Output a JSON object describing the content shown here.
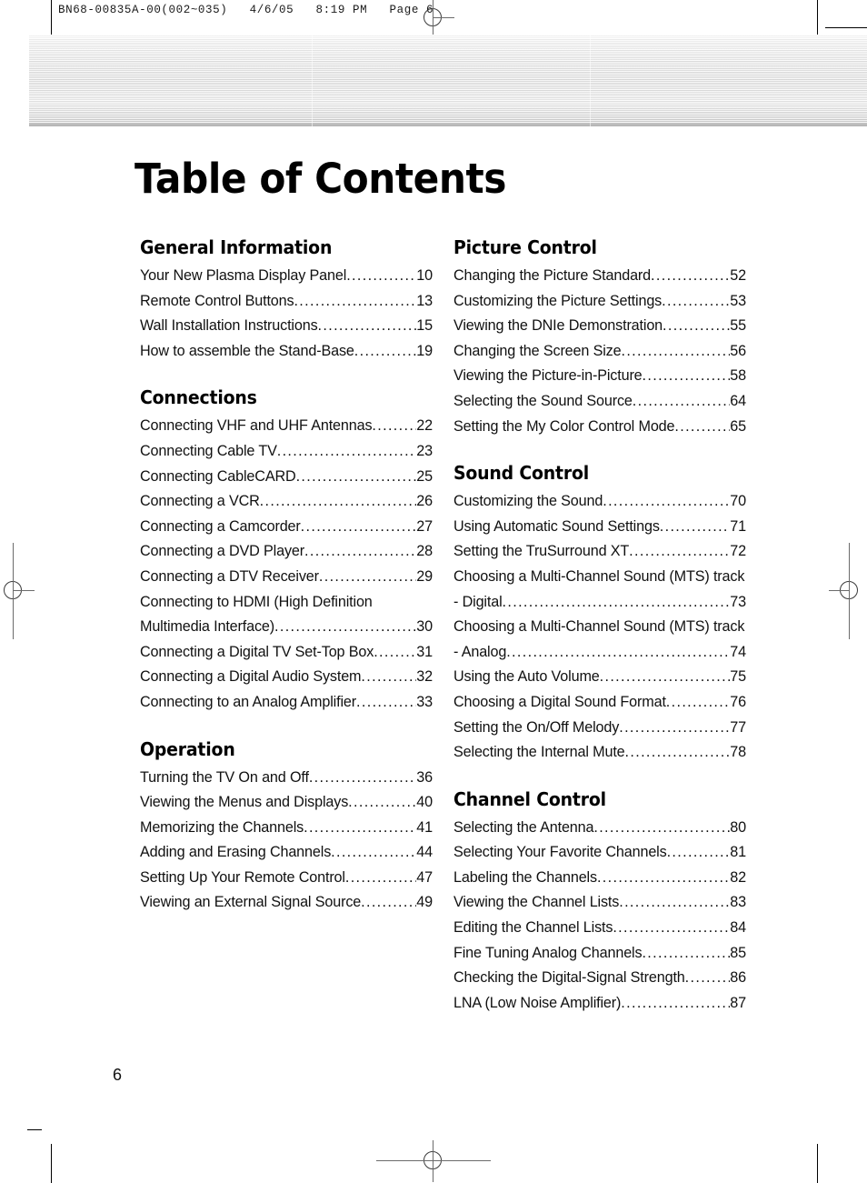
{
  "print_header": "BN68-00835A-00(002~035)   4/6/05   8:19 PM   Page 6",
  "page_title": "Table of Contents",
  "folio": "6",
  "columns": {
    "left": [
      {
        "heading": "General Information",
        "entries": [
          {
            "title": "Your New Plasma Display Panel",
            "dots": "....................",
            "page": "10"
          },
          {
            "title": "Remote Control Buttons ",
            "dots": "................................",
            "page": "13"
          },
          {
            "title": "Wall Installation Instructions ",
            "dots": "..........................",
            "page": "15"
          },
          {
            "title": "How to assemble the Stand-Base ",
            "dots": "..................",
            "page": "19"
          }
        ]
      },
      {
        "heading": "Connections",
        "entries": [
          {
            "title": "Connecting VHF and UHF Antennas ",
            "dots": "..............",
            "page": "22"
          },
          {
            "title": "Connecting Cable TV ",
            "dots": "...................................",
            "page": "23"
          },
          {
            "title": "Connecting CableCARD ",
            "dots": ".............................",
            "page": "25"
          },
          {
            "title": "Connecting a VCR ",
            "dots": ".......................................",
            "page": "26"
          },
          {
            "title": "Connecting a Camcorder ",
            "dots": "............................",
            "page": "27"
          },
          {
            "title": "Connecting a DVD Player ",
            "dots": "...........................",
            "page": "28"
          },
          {
            "title": "Connecting a DTV Receiver ",
            "dots": ".........................",
            "page": "29"
          },
          {
            "title": "Connecting to HDMI (High Definition",
            "line2": "Multimedia Interface) ",
            "dots": "..................................",
            "page": "30"
          },
          {
            "title": "Connecting a Digital TV Set-Top Box",
            "dots": "..............",
            "page": "31"
          },
          {
            "title": "Connecting a Digital Audio System ",
            "dots": "..............",
            "page": "32"
          },
          {
            "title": "Connecting to an Analog Amplifier ",
            "dots": "..............",
            "page": "33"
          }
        ]
      },
      {
        "heading": "Operation",
        "entries": [
          {
            "title": "Turning the TV On and Off ",
            "dots": "..........................",
            "page": "36"
          },
          {
            "title": "Viewing the Menus and Displays ",
            "dots": "..................",
            "page": "40"
          },
          {
            "title": "Memorizing the Channels ",
            "dots": "............................",
            "page": "41"
          },
          {
            "title": "Adding and Erasing Channels ",
            "dots": ".......................",
            "page": "44"
          },
          {
            "title": "Setting Up Your Remote Control ",
            "dots": "....................",
            "page": "47"
          },
          {
            "title": "Viewing an External Signal Source",
            "dots": "................",
            "page": "49"
          }
        ]
      }
    ],
    "right": [
      {
        "heading": "Picture Control",
        "entries": [
          {
            "title": "Changing the Picture Standard  ",
            "dots": "....................",
            "page": "52"
          },
          {
            "title": "Customizing the Picture Settings ",
            "dots": "....................",
            "page": "53"
          },
          {
            "title": "Viewing the DNIe Demonstration ",
            "dots": ".................",
            "page": "55"
          },
          {
            "title": "Changing the Screen Size ",
            "dots": "............................",
            "page": "56"
          },
          {
            "title": "Viewing the Picture-in-Picture",
            "dots": "........................",
            "page": "58"
          },
          {
            "title": "Selecting the Sound Source  ",
            "dots": ".........................",
            "page": "64"
          },
          {
            "title": "Setting the My Color Control Mode",
            "dots": "...............",
            "page": "65"
          }
        ]
      },
      {
        "heading": "Sound Control",
        "entries": [
          {
            "title": "Customizing the Sound   ",
            "dots": ".............................",
            "page": "70"
          },
          {
            "title": "Using Automatic Sound Settings ",
            "dots": "...................",
            "page": "71"
          },
          {
            "title": "Setting the TruSurround XT",
            "dots": "...........................",
            "page": "72"
          },
          {
            "title": "Choosing a Multi-Channel Sound (MTS) track",
            "line2": "- Digital ",
            "dots": "......................................................",
            "page": "73"
          },
          {
            "title": "Choosing a Multi-Channel Sound (MTS) track",
            "line2": "- Analog  ",
            "dots": "....................................................",
            "page": "74"
          },
          {
            "title": "Using the Auto Volume ",
            "dots": "................................",
            "page": "75"
          },
          {
            "title": "Choosing a Digital Sound Format",
            "dots": "..................",
            "page": "76"
          },
          {
            "title": "Setting the On/Off Melody ",
            "dots": "..........................",
            "page": "77"
          },
          {
            "title": "Selecting the Internal Mute  ",
            "dots": ".........................",
            "page": "78"
          }
        ]
      },
      {
        "heading": "Channel Control",
        "entries": [
          {
            "title": "Selecting the Antenna ",
            "dots": ".................................",
            "page": "80"
          },
          {
            "title": "Selecting Your Favorite Channels ",
            "dots": "..................",
            "page": "81"
          },
          {
            "title": "Labeling the Channels",
            "dots": ".................................",
            "page": "82"
          },
          {
            "title": "Viewing the Channel Lists ",
            "dots": "............................",
            "page": "83"
          },
          {
            "title": "Editing the Channel Lists ",
            "dots": "..............................",
            "page": "84"
          },
          {
            "title": "Fine Tuning Analog Channels  ",
            "dots": ".....................",
            "page": "85"
          },
          {
            "title": "Checking the Digital-Signal Strength ",
            "dots": "..............",
            "page": "86"
          },
          {
            "title": "LNA (Low Noise Amplifier)  ",
            "dots": ".........................",
            "page": "87"
          }
        ]
      }
    ]
  }
}
